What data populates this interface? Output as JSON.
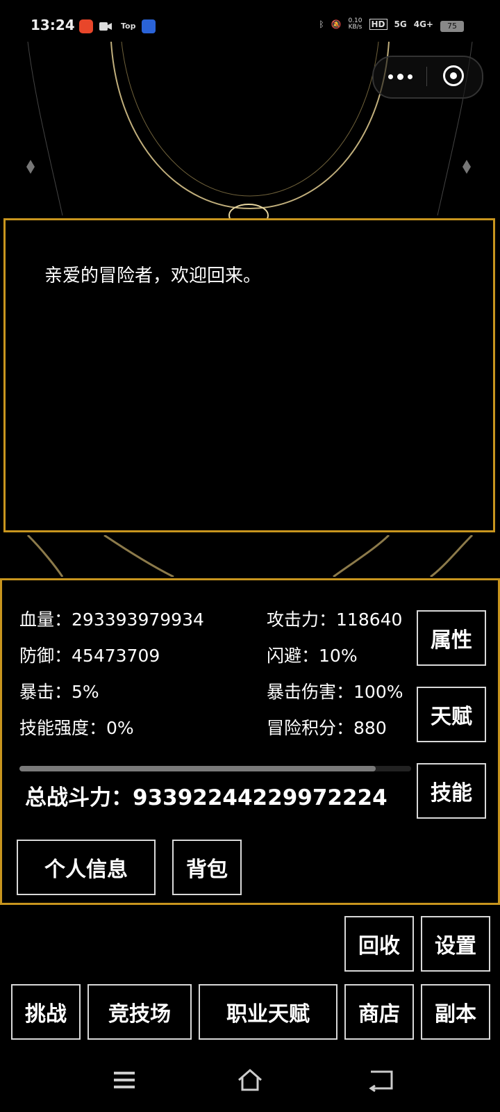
{
  "status_bar": {
    "time": "13:24",
    "tap_label": "Top",
    "network_speed": "0.10",
    "network_unit": "KB/s",
    "hd_label": "HD",
    "signal_1": "5G",
    "signal_2": "4G+",
    "battery": "75"
  },
  "capsule": {
    "menu_icon": "more-dots-icon",
    "close_icon": "target-icon"
  },
  "dialog": {
    "message": "亲爱的冒险者，欢迎回来。"
  },
  "stats": {
    "hp_label": "血量：",
    "hp_value": "293393979934",
    "atk_label": "攻击力：",
    "atk_value": "118640",
    "def_label": "防御：",
    "def_value": "45473709",
    "dodge_label": "闪避：",
    "dodge_value": "10%",
    "crit_label": "暴击：",
    "crit_value": "5%",
    "crit_dmg_label": "暴击伤害：",
    "crit_dmg_value": "100%",
    "skill_power_label": "技能强度：",
    "skill_power_value": "0%",
    "score_label": "冒险积分：",
    "score_value": "880",
    "progress": 0.91,
    "total_label": "总战斗力：",
    "total_value": "93392244229972224"
  },
  "side_buttons": {
    "attributes": "属性",
    "talent": "天赋",
    "skills": "技能"
  },
  "panel_buttons": {
    "profile": "个人信息",
    "bag": "背包"
  },
  "bottom_buttons": {
    "recycle": "回收",
    "settings": "设置",
    "challenge": "挑战",
    "arena": "竞技场",
    "class_talent": "职业天赋",
    "shop": "商店",
    "dungeon": "副本"
  },
  "colors": {
    "gold_border": "#c8951e",
    "button_border": "#d9d9d9",
    "progress_fill": "#7a7a7a"
  }
}
